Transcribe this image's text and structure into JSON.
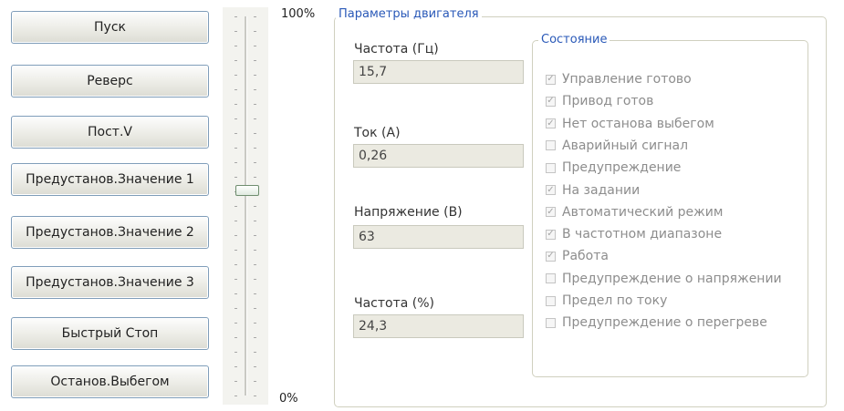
{
  "buttons": [
    {
      "name": "start-button",
      "label": "Пуск"
    },
    {
      "name": "reverse-button",
      "label": "Реверс"
    },
    {
      "name": "const-v-button",
      "label": "Пост.V"
    },
    {
      "name": "preset-1-button",
      "label": "Предустанов.Значение 1"
    },
    {
      "name": "preset-2-button",
      "label": "Предустанов.Значение 2"
    },
    {
      "name": "preset-3-button",
      "label": "Предустанов.Значение 3"
    },
    {
      "name": "quick-stop-button",
      "label": "Быстрый Стоп"
    },
    {
      "name": "coast-stop-button",
      "label": "Останов.Выбегом"
    }
  ],
  "slider": {
    "max_label": "100%",
    "min_label": "0%",
    "value_percent": 54
  },
  "motor": {
    "title": "Параметры двигателя",
    "fields": [
      {
        "label": "Частота (Гц)",
        "value": "15,7"
      },
      {
        "label": "Ток (А)",
        "value": "0,26"
      },
      {
        "label": "Напряжение (В)",
        "value": "63"
      },
      {
        "label": "Частота (%)",
        "value": "24,3"
      }
    ]
  },
  "status": {
    "title": "Состояние",
    "check_glyph": "✓",
    "items": [
      {
        "label": "Управление готово",
        "checked": true
      },
      {
        "label": "Привод готов",
        "checked": true
      },
      {
        "label": "Нет останова выбегом",
        "checked": true
      },
      {
        "label": "Аварийный сигнал",
        "checked": false
      },
      {
        "label": "Предупреждение",
        "checked": false
      },
      {
        "label": "На задании",
        "checked": true
      },
      {
        "label": "Автоматический режим",
        "checked": true
      },
      {
        "label": "В частотном диапазоне",
        "checked": true
      },
      {
        "label": "Работа",
        "checked": true
      },
      {
        "label": "Предупреждение о напряжении",
        "checked": false
      },
      {
        "label": "Предел по току",
        "checked": false
      },
      {
        "label": "Предупреждение о перегреве",
        "checked": false
      }
    ]
  }
}
